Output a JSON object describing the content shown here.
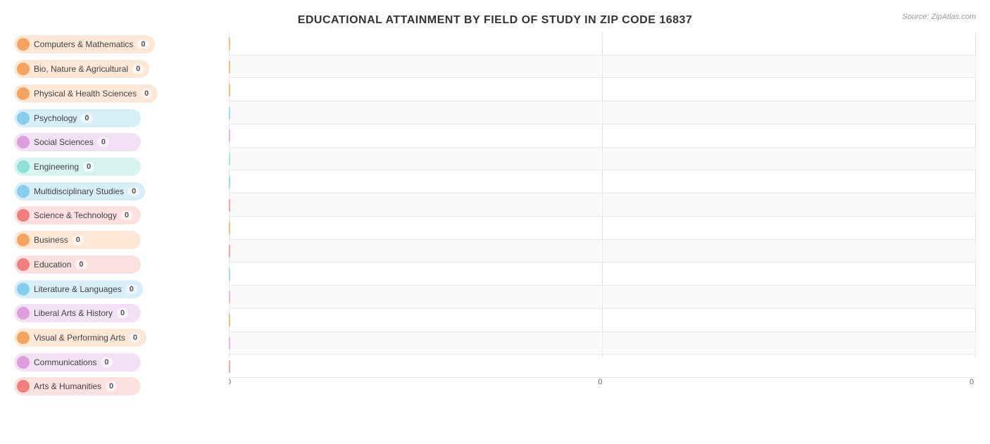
{
  "title": "EDUCATIONAL ATTAINMENT BY FIELD OF STUDY IN ZIP CODE 16837",
  "source": "Source: ZipAtlas.com",
  "categories": [
    {
      "label": "Computers & Mathematics",
      "value": 0,
      "circleColor": "#f4a460",
      "pillColor": "#fde8d8"
    },
    {
      "label": "Bio, Nature & Agricultural",
      "value": 0,
      "circleColor": "#f4a460",
      "pillColor": "#fde8d8"
    },
    {
      "label": "Physical & Health Sciences",
      "value": 0,
      "circleColor": "#f4a460",
      "pillColor": "#fde8d8"
    },
    {
      "label": "Psychology",
      "value": 0,
      "circleColor": "#87ceeb",
      "pillColor": "#d8eef8"
    },
    {
      "label": "Social Sciences",
      "value": 0,
      "circleColor": "#dda0dd",
      "pillColor": "#f2e0f5"
    },
    {
      "label": "Engineering",
      "value": 0,
      "circleColor": "#90e0d8",
      "pillColor": "#d8f4f0"
    },
    {
      "label": "Multidisciplinary Studies",
      "value": 0,
      "circleColor": "#87ceeb",
      "pillColor": "#d8eef8"
    },
    {
      "label": "Science & Technology",
      "value": 0,
      "circleColor": "#f08080",
      "pillColor": "#fde0e0"
    },
    {
      "label": "Business",
      "value": 0,
      "circleColor": "#f4a460",
      "pillColor": "#fde8d8"
    },
    {
      "label": "Education",
      "value": 0,
      "circleColor": "#f08080",
      "pillColor": "#fde0e0"
    },
    {
      "label": "Literature & Languages",
      "value": 0,
      "circleColor": "#87ceeb",
      "pillColor": "#d8eef8"
    },
    {
      "label": "Liberal Arts & History",
      "value": 0,
      "circleColor": "#dda0dd",
      "pillColor": "#f2e0f5"
    },
    {
      "label": "Visual & Performing Arts",
      "value": 0,
      "circleColor": "#f4a460",
      "pillColor": "#fde8d8"
    },
    {
      "label": "Communications",
      "value": 0,
      "circleColor": "#dda0dd",
      "pillColor": "#f2e0f5"
    },
    {
      "label": "Arts & Humanities",
      "value": 0,
      "circleColor": "#f08080",
      "pillColor": "#fde0e0"
    }
  ],
  "xAxisLabels": [
    "0",
    "0",
    "0"
  ],
  "valueLabel": "0"
}
